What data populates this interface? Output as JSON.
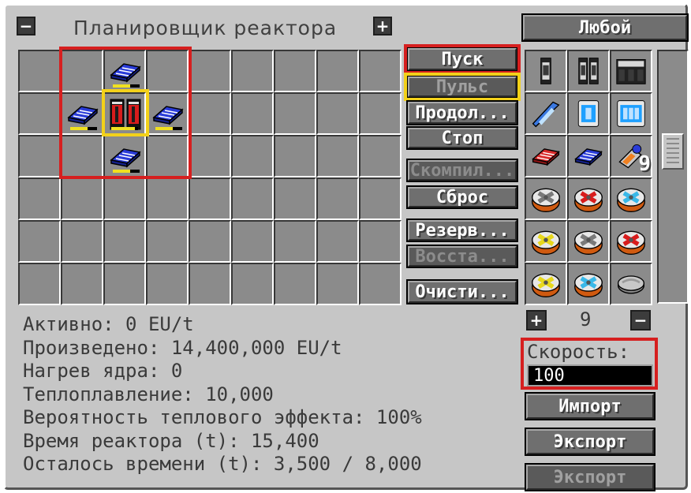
{
  "title": "Планировщик реактора",
  "header": {
    "collapse_symbol": "−",
    "expand_symbol": "+",
    "filter_button": "Любой"
  },
  "controls": {
    "start": "Пуск",
    "pulse": "Пульс",
    "continue": "Продол...",
    "stop": "Стоп",
    "compile": "Скомпил...",
    "reset": "Сброс",
    "backup": "Резерв...",
    "restore": "Восста...",
    "clear": "Очисти..."
  },
  "reactor_grid": {
    "rows": 6,
    "cols": 9,
    "components": [
      {
        "row": 0,
        "col": 2,
        "item": "heat-vent-icon"
      },
      {
        "row": 1,
        "col": 1,
        "item": "heat-vent-icon"
      },
      {
        "row": 1,
        "col": 2,
        "item": "quad-uranium-rod-icon"
      },
      {
        "row": 1,
        "col": 3,
        "item": "heat-vent-icon"
      },
      {
        "row": 2,
        "col": 2,
        "item": "heat-vent-icon"
      }
    ]
  },
  "stats": [
    "Активно: 0 EU/t",
    "Произведено: 14,400,000 EU/t",
    "Нагрев ядра: 0",
    "Теплоплавление: 10,000",
    "Вероятность теплового эффекта: 100%",
    "Время реактора (t): 15,400",
    "Осталось времени (t): 3,500 / 8,000"
  ],
  "palette": {
    "items": [
      {
        "name": "single-fuel-rod-icon"
      },
      {
        "name": "dual-fuel-rod-icon"
      },
      {
        "name": "quad-fuel-rod-icon"
      },
      {
        "name": "neutron-reflector-icon"
      },
      {
        "name": "coolant-cell-icon"
      },
      {
        "name": "triple-coolant-cell-icon"
      },
      {
        "name": "red-heat-vent-icon"
      },
      {
        "name": "blue-heat-vent-icon"
      },
      {
        "name": "component-heat-vent-icon",
        "count": "9"
      },
      {
        "name": "gray-heat-exchanger-icon"
      },
      {
        "name": "red-heat-exchanger-icon"
      },
      {
        "name": "blue-heat-exchanger-icon"
      },
      {
        "name": "yellow-heat-exchanger-icon"
      },
      {
        "name": "gray-heat-exchanger-icon"
      },
      {
        "name": "red-heat-exchanger-icon"
      },
      {
        "name": "yellow-heat-exchanger-icon"
      },
      {
        "name": "blue-heat-exchanger-icon"
      },
      {
        "name": "plating-icon"
      }
    ]
  },
  "pager": {
    "plus": "+",
    "value": "9",
    "minus": "−"
  },
  "speed": {
    "label": "Скорость:",
    "value": "100"
  },
  "actions": {
    "import": "Импорт",
    "export": "Экспорт",
    "export_disabled": "Экспорт"
  },
  "colors": {
    "highlight_red": "#d61f1f",
    "highlight_yellow": "#f3d11a",
    "panel": "#c6c6c6",
    "slot": "#8b8b8b"
  }
}
